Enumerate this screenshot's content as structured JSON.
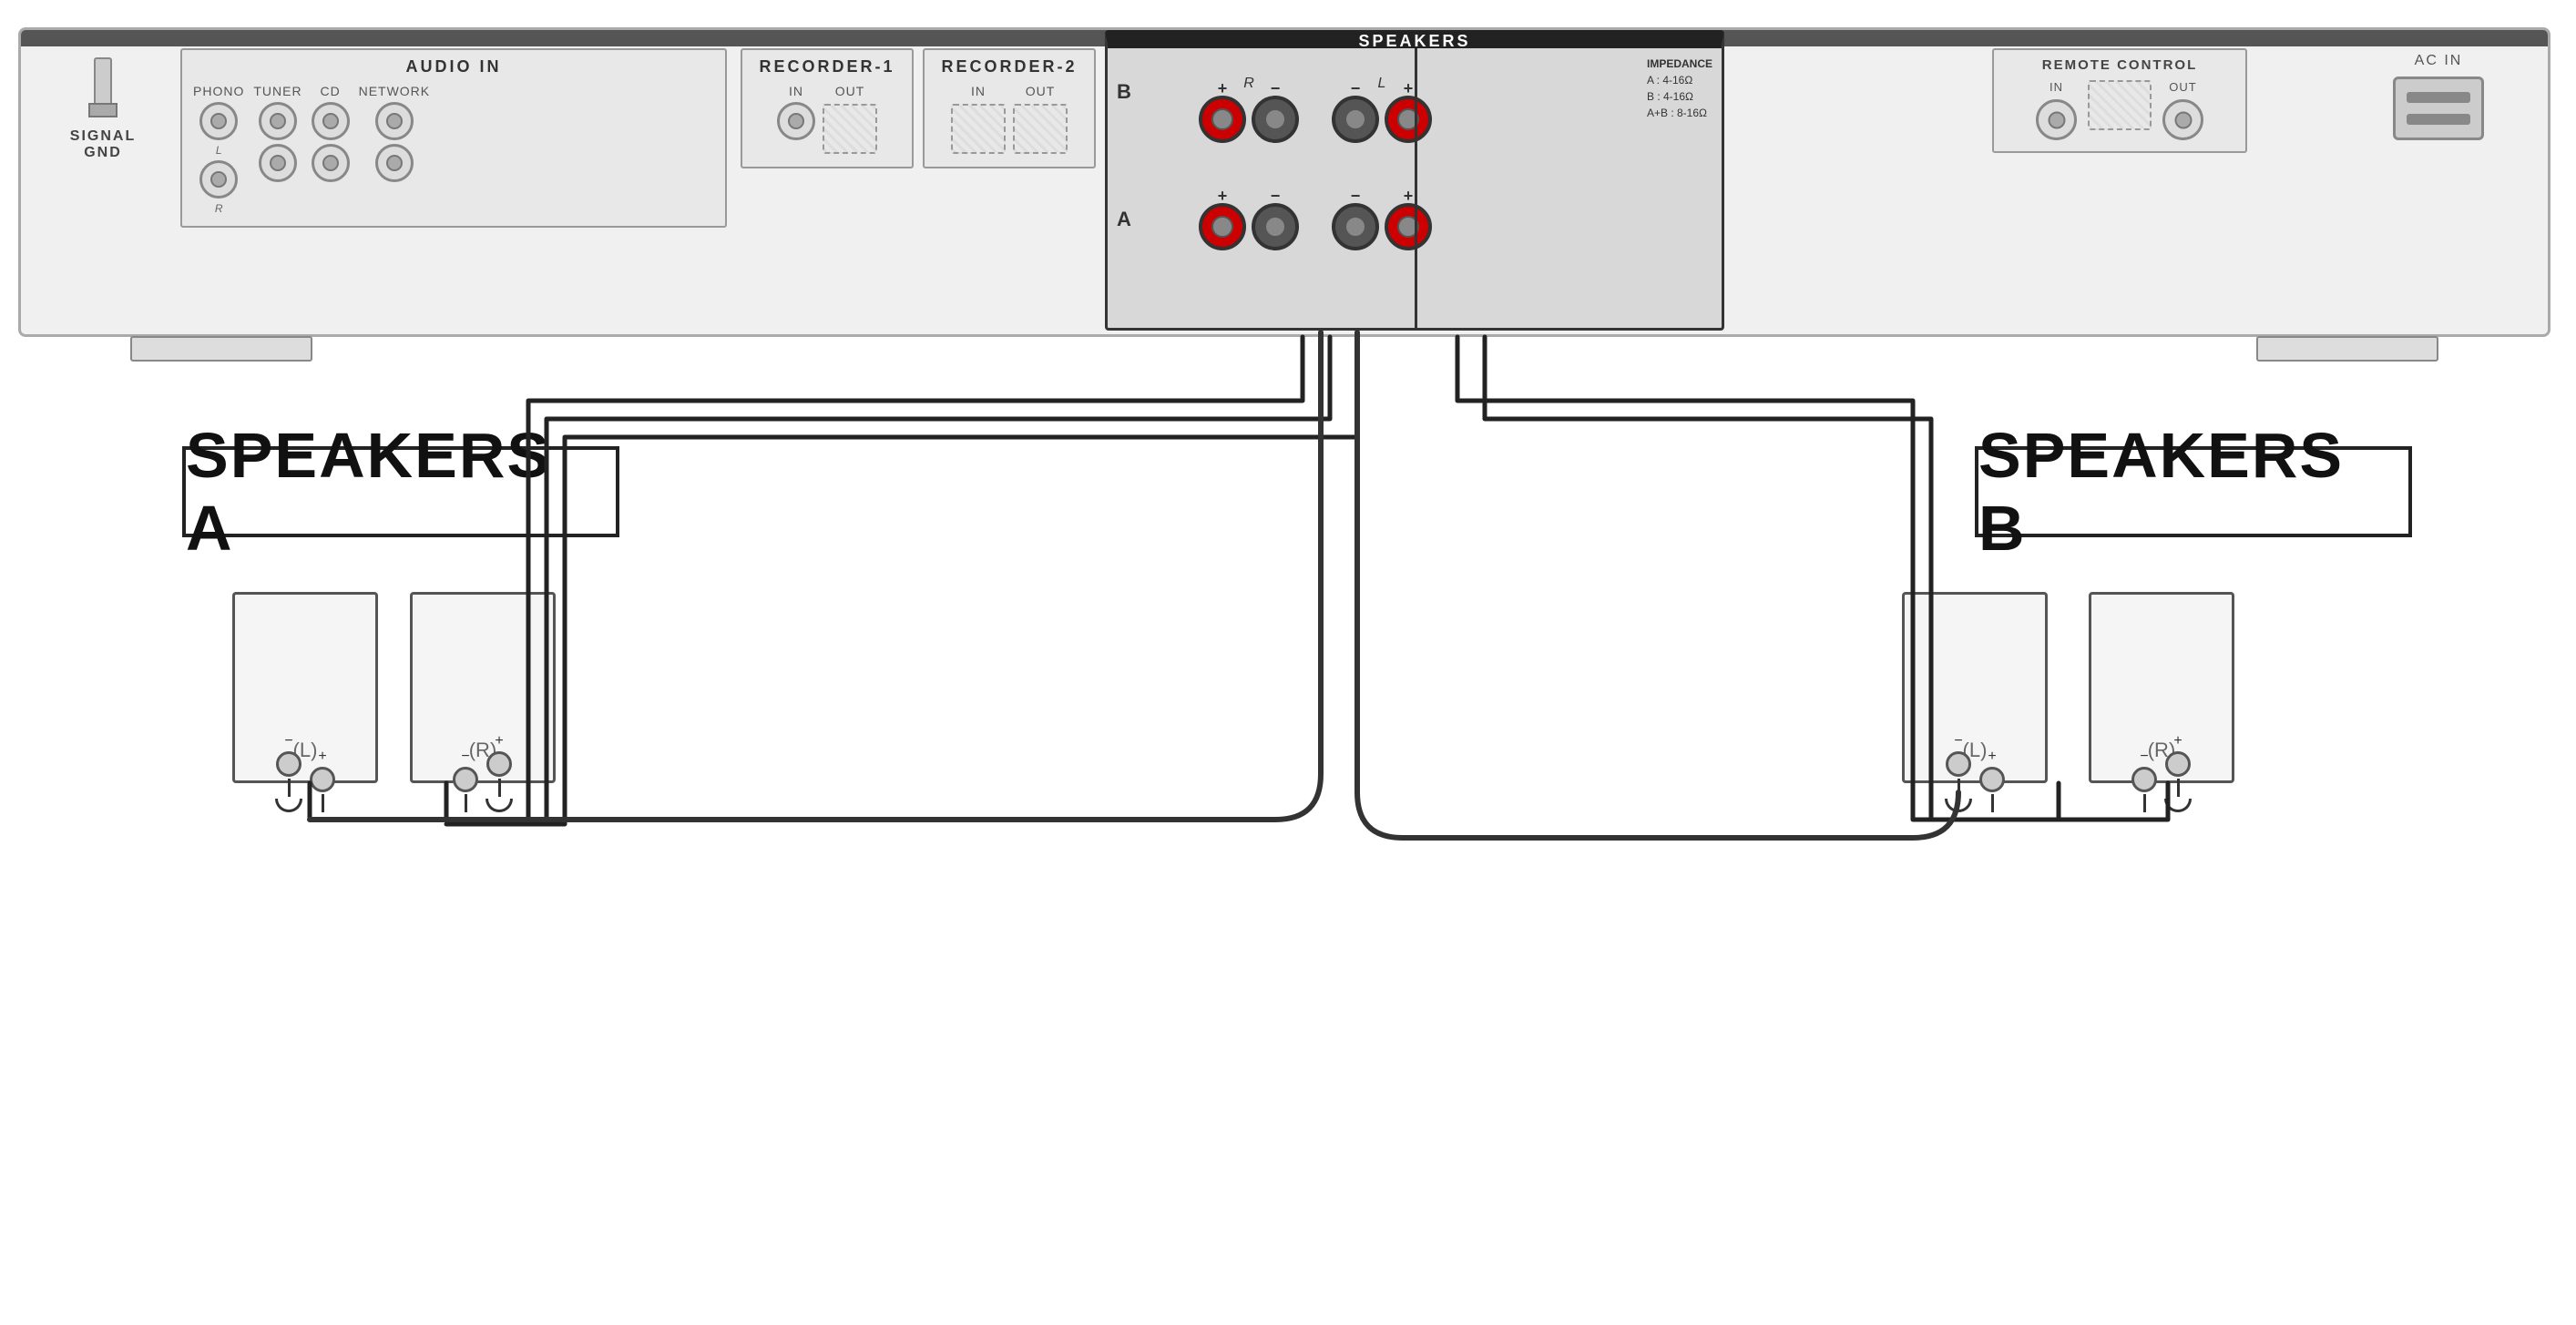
{
  "amp": {
    "signal_gnd_label": "SIGNAL\nGND",
    "audio_in_label": "AUDIO  IN",
    "phono_label": "PHONO",
    "tuner_label": "TUNER",
    "cd_label": "CD",
    "network_label": "NETWORK",
    "recorder1_label": "RECORDER-1",
    "recorder2_label": "RECORDER-2",
    "in_label": "IN",
    "out_label": "OUT",
    "speakers_label": "SPEAKERS",
    "impedance_label": "IMPEDANCE",
    "impedance_a": "A : 4-16Ω",
    "impedance_b": "B : 4-16Ω",
    "impedance_ab": "A+B : 8-16Ω",
    "row_b": "B",
    "row_a": "A",
    "spk_r_label": "R",
    "spk_l_label": "L",
    "remote_control_label": "REMOTE CONTROL",
    "remote_in_label": "IN",
    "remote_out_label": "OUT",
    "ac_in_label": "AC IN"
  },
  "speakers_a": {
    "label": "SPEAKERS A",
    "left_label": "(L)",
    "right_label": "(R)"
  },
  "speakers_b": {
    "label": "SPEAKERS B",
    "left_label": "(L)",
    "right_label": "(R)"
  },
  "icons": {
    "plus": "+",
    "minus": "−"
  }
}
